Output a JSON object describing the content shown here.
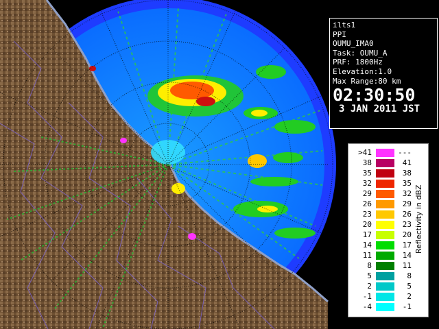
{
  "info": {
    "radar": "ilts1",
    "mode": "PPI",
    "site": "OUMU_IMA0",
    "task": "Task: OUMU_A",
    "prf": "PRF: 1800Hz",
    "elevation": "Elevation:1.0",
    "max_range": "Max Range:80 km",
    "time": "02:30:50",
    "date": "3 JAN 2011 JST"
  },
  "legend": {
    "unit": "Reflectivity in dBZ",
    "entries": [
      {
        "lo": ">41",
        "hi": "---",
        "color": "#ff33ff"
      },
      {
        "lo": "38",
        "hi": "41",
        "color": "#b80063"
      },
      {
        "lo": "35",
        "hi": "38",
        "color": "#c00010"
      },
      {
        "lo": "32",
        "hi": "35",
        "color": "#ee2600"
      },
      {
        "lo": "29",
        "hi": "32",
        "color": "#ff5a00"
      },
      {
        "lo": "26",
        "hi": "29",
        "color": "#ff9900"
      },
      {
        "lo": "23",
        "hi": "26",
        "color": "#ffc800"
      },
      {
        "lo": "20",
        "hi": "23",
        "color": "#ffff00"
      },
      {
        "lo": "17",
        "hi": "20",
        "color": "#c8ff00"
      },
      {
        "lo": "14",
        "hi": "17",
        "color": "#00dd00"
      },
      {
        "lo": "11",
        "hi": "14",
        "color": "#00aa00"
      },
      {
        "lo": "8",
        "hi": "11",
        "color": "#007f00"
      },
      {
        "lo": "5",
        "hi": "8",
        "color": "#00a0a0"
      },
      {
        "lo": "2",
        "hi": "5",
        "color": "#00c8c8"
      },
      {
        "lo": "-1",
        "hi": "2",
        "color": "#00e6e6"
      },
      {
        "lo": "-4",
        "hi": "-1",
        "color": "#00ffff"
      }
    ]
  },
  "colors": {
    "range_circle": "#1e3cff",
    "ocean_echo": "#0a6dff",
    "land": "#7a5a3a",
    "background": "#000000"
  }
}
